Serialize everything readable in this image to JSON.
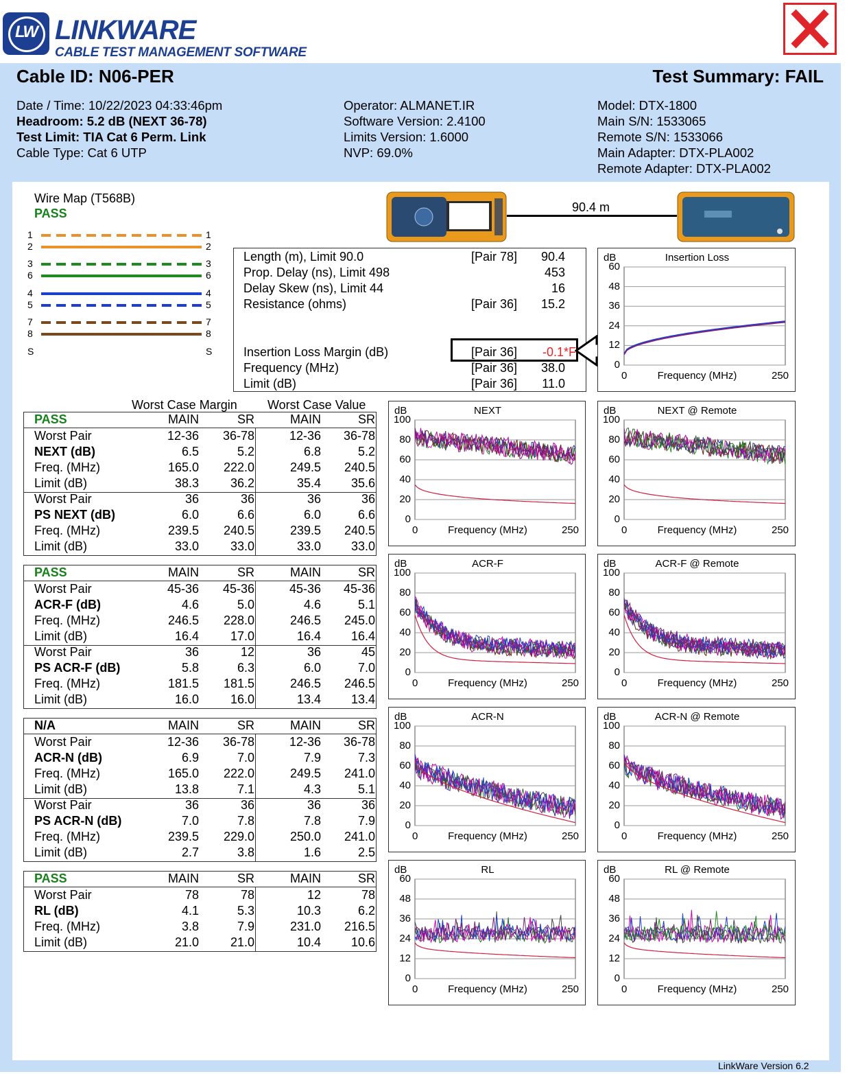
{
  "brand": {
    "logo_text": "LW",
    "name": "LINKWARE",
    "tagline": "CABLE TEST MANAGEMENT SOFTWARE"
  },
  "header": {
    "cable_id": "Cable ID: N06-PER",
    "summary": "Test Summary: FAIL",
    "fail_mark": "X"
  },
  "meta_left": {
    "date": "Date / Time: 10/22/2023 04:33:46pm",
    "headroom": "Headroom: 5.2 dB (NEXT 36-78)",
    "limit": "Test Limit: TIA Cat 6 Perm. Link",
    "cable_type": "Cable Type: Cat 6 UTP"
  },
  "meta_mid": {
    "operator": "Operator: ALMANET.IR",
    "software": "Software Version: 2.4100",
    "limits_version": "Limits Version: 1.6000",
    "nvp": "NVP: 69.0%"
  },
  "meta_right": {
    "model": "Model: DTX-1800",
    "main_sn": "Main S/N: 1533065",
    "remote_sn": "Remote S/N: 1533066",
    "main_adapter": "Main Adapter: DTX-PLA002",
    "remote_adapter": "Remote Adapter: DTX-PLA002"
  },
  "wiremap": {
    "title": "Wire Map (T568B)",
    "status": "PASS",
    "pairs": [
      {
        "l": "1",
        "r": "1",
        "color": "#e8922e",
        "style": "dashed"
      },
      {
        "l": "2",
        "r": "2",
        "color": "#e8922e",
        "style": "solid"
      },
      {
        "l": "3",
        "r": "3",
        "color": "#1f8a1f",
        "style": "dashed"
      },
      {
        "l": "6",
        "r": "6",
        "color": "#1f8a1f",
        "style": "solid"
      },
      {
        "l": "4",
        "r": "4",
        "color": "#1d3fd0",
        "style": "solid"
      },
      {
        "l": "5",
        "r": "5",
        "color": "#1d3fd0",
        "style": "dashed"
      },
      {
        "l": "7",
        "r": "7",
        "color": "#7a4a1c",
        "style": "dashed"
      },
      {
        "l": "8",
        "r": "8",
        "color": "#7a4a1c",
        "style": "solid"
      },
      {
        "l": "S",
        "r": "S",
        "color": "",
        "style": "none"
      }
    ]
  },
  "link": {
    "length_label": "90.4 m"
  },
  "measurements": [
    {
      "label": "Length (m), Limit 90.0",
      "pair": "[Pair 78]",
      "value": "90.4"
    },
    {
      "label": "Prop. Delay (ns), Limit 498",
      "pair": "",
      "value": "453"
    },
    {
      "label": "Delay Skew (ns), Limit 44",
      "pair": "",
      "value": "16"
    },
    {
      "label": "Resistance (ohms)",
      "pair": "[Pair 36]",
      "value": "15.2"
    },
    {
      "label": "Insertion Loss Margin (dB)",
      "pair": "[Pair 36]",
      "value": "-0.1*F"
    },
    {
      "label": "Frequency (MHz)",
      "pair": "[Pair 36]",
      "value": "38.0"
    },
    {
      "label": "Limit (dB)",
      "pair": "[Pair 36]",
      "value": "11.0"
    }
  ],
  "table_headers": {
    "margin": "Worst Case Margin",
    "value": "Worst Case Value",
    "cols": [
      "MAIN",
      "SR",
      "MAIN",
      "SR"
    ]
  },
  "tables": [
    {
      "status": "PASS",
      "rows": [
        {
          "label": "Worst Pair",
          "bold": false,
          "v": [
            "12-36",
            "36-78",
            "12-36",
            "36-78"
          ]
        },
        {
          "label": "NEXT (dB)",
          "bold": true,
          "v": [
            "6.5",
            "5.2",
            "6.8",
            "5.2"
          ]
        },
        {
          "label": "Freq. (MHz)",
          "bold": false,
          "v": [
            "165.0",
            "222.0",
            "249.5",
            "240.5"
          ]
        },
        {
          "label": "Limit (dB)",
          "bold": false,
          "v": [
            "38.3",
            "36.2",
            "35.4",
            "35.6"
          ]
        },
        {
          "label": "Worst Pair",
          "bold": false,
          "v": [
            "36",
            "36",
            "36",
            "36"
          ]
        },
        {
          "label": "PS NEXT (dB)",
          "bold": true,
          "v": [
            "6.0",
            "6.6",
            "6.0",
            "6.6"
          ]
        },
        {
          "label": "Freq. (MHz)",
          "bold": false,
          "v": [
            "239.5",
            "240.5",
            "239.5",
            "240.5"
          ]
        },
        {
          "label": "Limit (dB)",
          "bold": false,
          "v": [
            "33.0",
            "33.0",
            "33.0",
            "33.0"
          ]
        }
      ]
    },
    {
      "status": "PASS",
      "rows": [
        {
          "label": "Worst Pair",
          "bold": false,
          "v": [
            "45-36",
            "45-36",
            "45-36",
            "45-36"
          ]
        },
        {
          "label": "ACR-F (dB)",
          "bold": true,
          "v": [
            "4.6",
            "5.0",
            "4.6",
            "5.1"
          ]
        },
        {
          "label": "Freq. (MHz)",
          "bold": false,
          "v": [
            "246.5",
            "228.0",
            "246.5",
            "245.0"
          ]
        },
        {
          "label": "Limit (dB)",
          "bold": false,
          "v": [
            "16.4",
            "17.0",
            "16.4",
            "16.4"
          ]
        },
        {
          "label": "Worst Pair",
          "bold": false,
          "v": [
            "36",
            "12",
            "36",
            "45"
          ]
        },
        {
          "label": "PS ACR-F (dB)",
          "bold": true,
          "v": [
            "5.8",
            "6.3",
            "6.0",
            "7.0"
          ]
        },
        {
          "label": "Freq. (MHz)",
          "bold": false,
          "v": [
            "181.5",
            "181.5",
            "246.5",
            "246.5"
          ]
        },
        {
          "label": "Limit (dB)",
          "bold": false,
          "v": [
            "16.0",
            "16.0",
            "13.4",
            "13.4"
          ]
        }
      ]
    },
    {
      "status": "N/A",
      "rows": [
        {
          "label": "Worst Pair",
          "bold": false,
          "v": [
            "12-36",
            "36-78",
            "12-36",
            "36-78"
          ]
        },
        {
          "label": "ACR-N (dB)",
          "bold": true,
          "v": [
            "6.9",
            "7.0",
            "7.9",
            "7.3"
          ]
        },
        {
          "label": "Freq. (MHz)",
          "bold": false,
          "v": [
            "165.0",
            "222.0",
            "249.5",
            "241.0"
          ]
        },
        {
          "label": "Limit (dB)",
          "bold": false,
          "v": [
            "13.8",
            "7.1",
            "4.3",
            "5.1"
          ]
        },
        {
          "label": "Worst Pair",
          "bold": false,
          "v": [
            "36",
            "36",
            "36",
            "36"
          ]
        },
        {
          "label": "PS ACR-N (dB)",
          "bold": true,
          "v": [
            "7.0",
            "7.8",
            "7.8",
            "7.9"
          ]
        },
        {
          "label": "Freq. (MHz)",
          "bold": false,
          "v": [
            "239.5",
            "229.0",
            "250.0",
            "241.0"
          ]
        },
        {
          "label": "Limit (dB)",
          "bold": false,
          "v": [
            "2.7",
            "3.8",
            "1.6",
            "2.5"
          ]
        }
      ]
    },
    {
      "status": "PASS",
      "rows": [
        {
          "label": "Worst Pair",
          "bold": false,
          "v": [
            "78",
            "78",
            "12",
            "78"
          ]
        },
        {
          "label": "RL (dB)",
          "bold": true,
          "v": [
            "4.1",
            "5.3",
            "10.3",
            "6.2"
          ]
        },
        {
          "label": "Freq. (MHz)",
          "bold": false,
          "v": [
            "3.8",
            "7.9",
            "231.0",
            "216.5"
          ]
        },
        {
          "label": "Limit (dB)",
          "bold": false,
          "v": [
            "21.0",
            "21.0",
            "10.4",
            "10.6"
          ]
        }
      ]
    }
  ],
  "charts": [
    {
      "id": "il",
      "title": "Insertion Loss",
      "unit": "dB",
      "xlabel": "Frequency (MHz)",
      "xmin": "0",
      "xmax": "250",
      "yticks": [
        "60",
        "48",
        "36",
        "24",
        "12",
        "0"
      ],
      "kind": "il",
      "seed": 3
    },
    {
      "id": "next",
      "title": "NEXT",
      "unit": "dB",
      "xlabel": "Frequency (MHz)",
      "xmin": "0",
      "xmax": "250",
      "yticks": [
        "100",
        "80",
        "60",
        "40",
        "20",
        "0"
      ],
      "kind": "noise",
      "seed": 11
    },
    {
      "id": "next_r",
      "title": "NEXT @ Remote",
      "unit": "dB",
      "xlabel": "Frequency (MHz)",
      "xmin": "0",
      "xmax": "250",
      "yticks": [
        "100",
        "80",
        "60",
        "40",
        "20",
        "0"
      ],
      "kind": "noise",
      "seed": 17
    },
    {
      "id": "acrf",
      "title": "ACR-F",
      "unit": "dB",
      "xlabel": "Frequency (MHz)",
      "xmin": "0",
      "xmax": "250",
      "yticks": [
        "100",
        "80",
        "60",
        "40",
        "20",
        "0"
      ],
      "kind": "acrf",
      "seed": 23
    },
    {
      "id": "acrf_r",
      "title": "ACR-F @ Remote",
      "unit": "dB",
      "xlabel": "Frequency (MHz)",
      "xmin": "0",
      "xmax": "250",
      "yticks": [
        "100",
        "80",
        "60",
        "40",
        "20",
        "0"
      ],
      "kind": "acrf",
      "seed": 29
    },
    {
      "id": "acrn",
      "title": "ACR-N",
      "unit": "dB",
      "xlabel": "Frequency (MHz)",
      "xmin": "0",
      "xmax": "250",
      "yticks": [
        "100",
        "80",
        "60",
        "40",
        "20",
        "0"
      ],
      "kind": "acrn",
      "seed": 31
    },
    {
      "id": "acrn_r",
      "title": "ACR-N @ Remote",
      "unit": "dB",
      "xlabel": "Frequency (MHz)",
      "xmin": "0",
      "xmax": "250",
      "yticks": [
        "100",
        "80",
        "60",
        "40",
        "20",
        "0"
      ],
      "kind": "acrn",
      "seed": 37
    },
    {
      "id": "rl",
      "title": "RL",
      "unit": "dB",
      "xlabel": "Frequency (MHz)",
      "xmin": "0",
      "xmax": "250",
      "yticks": [
        "60",
        "48",
        "36",
        "24",
        "12",
        "0"
      ],
      "kind": "rl",
      "seed": 41
    },
    {
      "id": "rl_r",
      "title": "RL @ Remote",
      "unit": "dB",
      "xlabel": "Frequency (MHz)",
      "xmin": "0",
      "xmax": "250",
      "yticks": [
        "60",
        "48",
        "36",
        "24",
        "12",
        "0"
      ],
      "kind": "rl",
      "seed": 43
    }
  ],
  "colors": {
    "band": "#c6ddf7",
    "pass": "#17801a",
    "fail": "#e0252a",
    "brand": "#1c3f92"
  },
  "footer": {
    "version": "LinkWare Version  6.2"
  }
}
